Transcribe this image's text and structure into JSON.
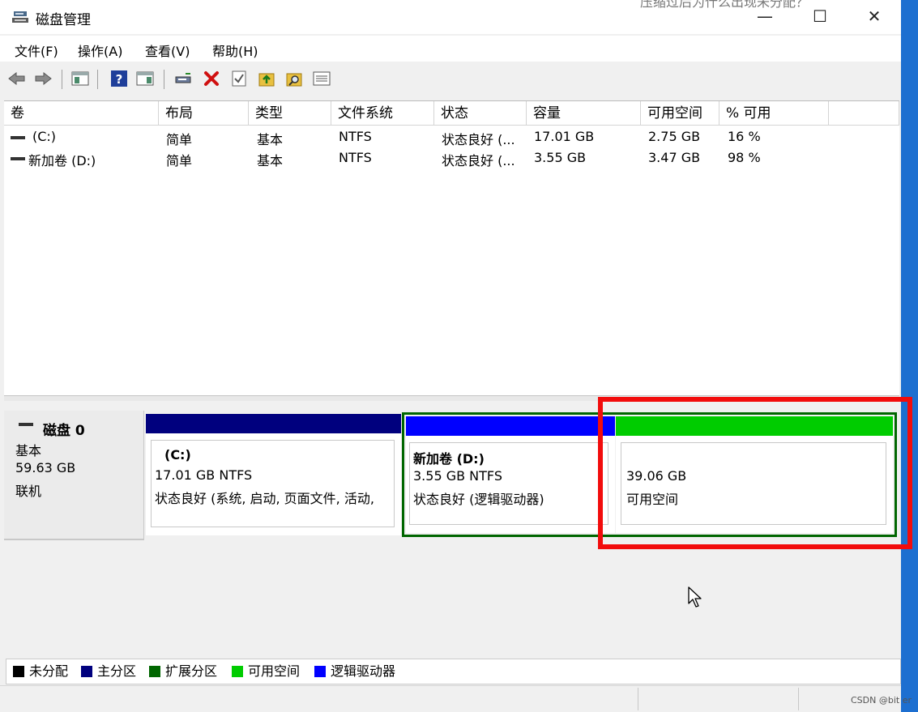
{
  "window": {
    "title": "磁盘管理",
    "overlay_caption": "压缩过后为什么出现未分配？",
    "minimize": "—",
    "maximize": "☐",
    "close": "✕"
  },
  "menu": [
    "文件(F)",
    "操作(A)",
    "查看(V)",
    "帮助(H)"
  ],
  "toolbar": [
    "back-icon",
    "forward-icon",
    "console-tree-icon",
    "help-icon",
    "properties-view-icon",
    "connect-disk-icon",
    "delete-icon",
    "check-icon",
    "up-folder-icon",
    "search-folder-icon",
    "list-view-icon"
  ],
  "volume_table": {
    "columns": [
      "卷",
      "布局",
      "类型",
      "文件系统",
      "状态",
      "容量",
      "可用空间",
      "% 可用"
    ],
    "rows": [
      [
        "(C:)",
        "简单",
        "基本",
        "NTFS",
        "状态良好 (...",
        "17.01 GB",
        "2.75 GB",
        "16 %"
      ],
      [
        "新加卷 (D:)",
        "简单",
        "基本",
        "NTFS",
        "状态良好 (...",
        "3.55 GB",
        "3.47 GB",
        "98 %"
      ]
    ]
  },
  "disk": {
    "name": "磁盘 0",
    "type": "基本",
    "size": "59.63 GB",
    "state": "联机",
    "partitions": [
      {
        "title": "(C:)",
        "size_fs": "17.01 GB NTFS",
        "status": "状态良好 (系统, 启动, 页面文件, 活动,",
        "bar_color": "#00007e"
      },
      {
        "title": "新加卷  (D:)",
        "size_fs": "3.55 GB NTFS",
        "status": "状态良好 (逻辑驱动器)",
        "bar_color": "#0000ff"
      },
      {
        "size_fs": "39.06 GB",
        "status": "可用空间",
        "bar_color": "#00cc00"
      }
    ]
  },
  "legend": [
    {
      "label": "未分配",
      "color": "#000000"
    },
    {
      "label": "主分区",
      "color": "#00007e"
    },
    {
      "label": "扩展分区",
      "color": "#006600"
    },
    {
      "label": "可用空间",
      "color": "#00cc00"
    },
    {
      "label": "逻辑驱动器",
      "color": "#0000ff"
    }
  ],
  "highlight_color": "#f20c0c",
  "watermark": "CSDN @bit er"
}
